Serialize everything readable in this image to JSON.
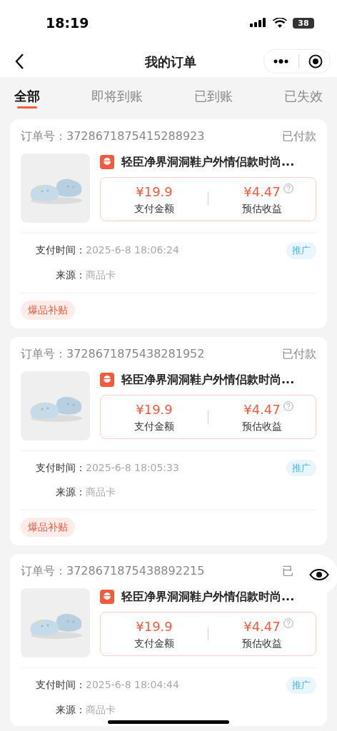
{
  "status_bar": {
    "time": "18:19",
    "battery": "38"
  },
  "nav": {
    "title": "我的订单"
  },
  "tabs": [
    {
      "label": "全部",
      "selected": true
    },
    {
      "label": "即将到账",
      "selected": false
    },
    {
      "label": "已到账",
      "selected": false
    },
    {
      "label": "已失效",
      "selected": false
    }
  ],
  "orders": [
    {
      "order_label": "订单号：",
      "order_no": "3728671875415288923",
      "status": "已付款",
      "title": "轻臣净界洞洞鞋户外情侣款时尚...",
      "pay_amount": "¥19.9",
      "pay_label": "支付金额",
      "income": "¥4.47",
      "income_label": "预估收益",
      "time_label": "支付时间：",
      "time": "2025-6-8 18:06:24",
      "badge": "推广",
      "source_label": "来源：",
      "source": "商品卡",
      "tag": "爆品补贴"
    },
    {
      "order_label": "订单号：",
      "order_no": "3728671875438281952",
      "status": "已付款",
      "title": "轻臣净界洞洞鞋户外情侣款时尚...",
      "pay_amount": "¥19.9",
      "pay_label": "支付金额",
      "income": "¥4.47",
      "income_label": "预估收益",
      "time_label": "支付时间：",
      "time": "2025-6-8 18:05:33",
      "badge": "推广",
      "source_label": "来源：",
      "source": "商品卡",
      "tag": "爆品补贴"
    },
    {
      "order_label": "订单号：",
      "order_no": "3728671875438892215",
      "status": "已",
      "title": "轻臣净界洞洞鞋户外情侣款时尚...",
      "pay_amount": "¥19.9",
      "pay_label": "支付金额",
      "income": "¥4.47",
      "income_label": "预估收益",
      "time_label": "支付时间：",
      "time": "2025-6-8 18:04:44",
      "badge": "推广",
      "source_label": "来源：",
      "source": "商品卡"
    }
  ]
}
